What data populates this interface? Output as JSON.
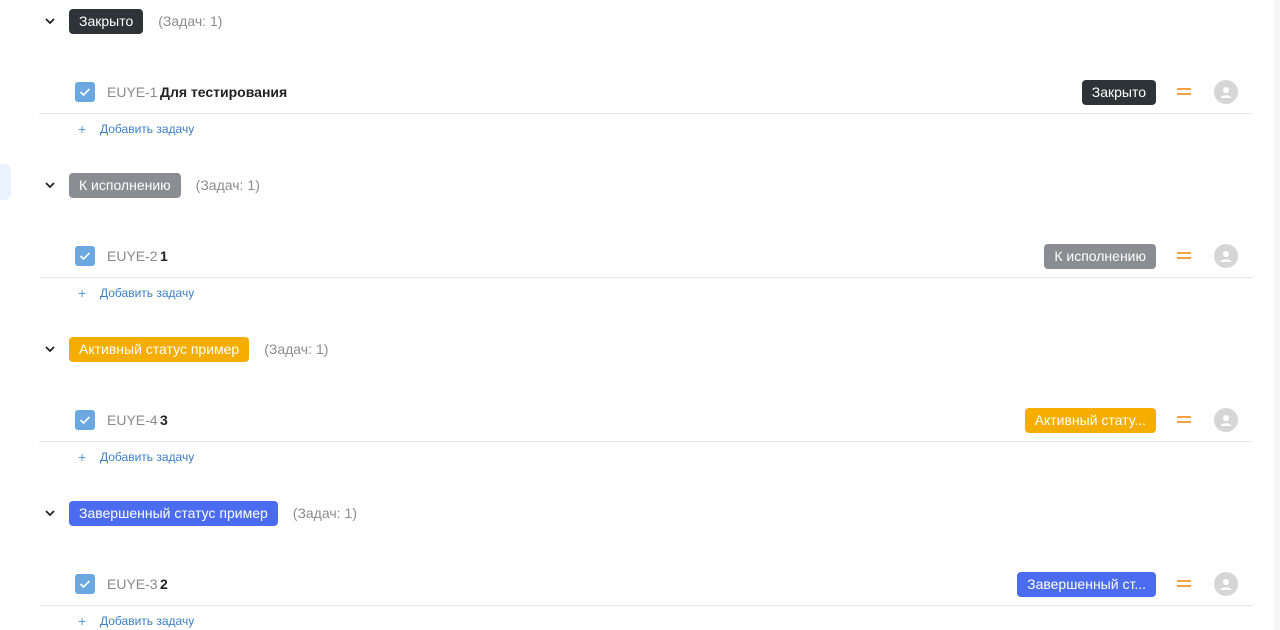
{
  "count_prefix": "(Задач:",
  "add_task_label": "Добавить задачу",
  "groups": [
    {
      "status": "Закрыто",
      "color": "#2e3338",
      "count": "1)",
      "task": {
        "key": "EUYE-1",
        "title": "Для тестирования",
        "status_label": "Закрыто"
      }
    },
    {
      "status": "К исполнению",
      "color": "#8a8d91",
      "count": "1)",
      "task": {
        "key": "EUYE-2",
        "title": "1",
        "status_label": "К исполнению"
      }
    },
    {
      "status": "Активный статус пример",
      "color": "#f5ad00",
      "count": "1)",
      "task": {
        "key": "EUYE-4",
        "title": "3",
        "status_label": "Активный стату..."
      }
    },
    {
      "status": "Завершенный статус пример",
      "color": "#4b6cf0",
      "count": "1)",
      "task": {
        "key": "EUYE-3",
        "title": "2",
        "status_label": "Завершенный ст..."
      }
    }
  ],
  "icons": {
    "chevron": "chevron-down-icon",
    "check": "check-icon",
    "priority": "priority-medium-icon",
    "avatar": "user-avatar-icon",
    "plus": "plus-icon"
  }
}
